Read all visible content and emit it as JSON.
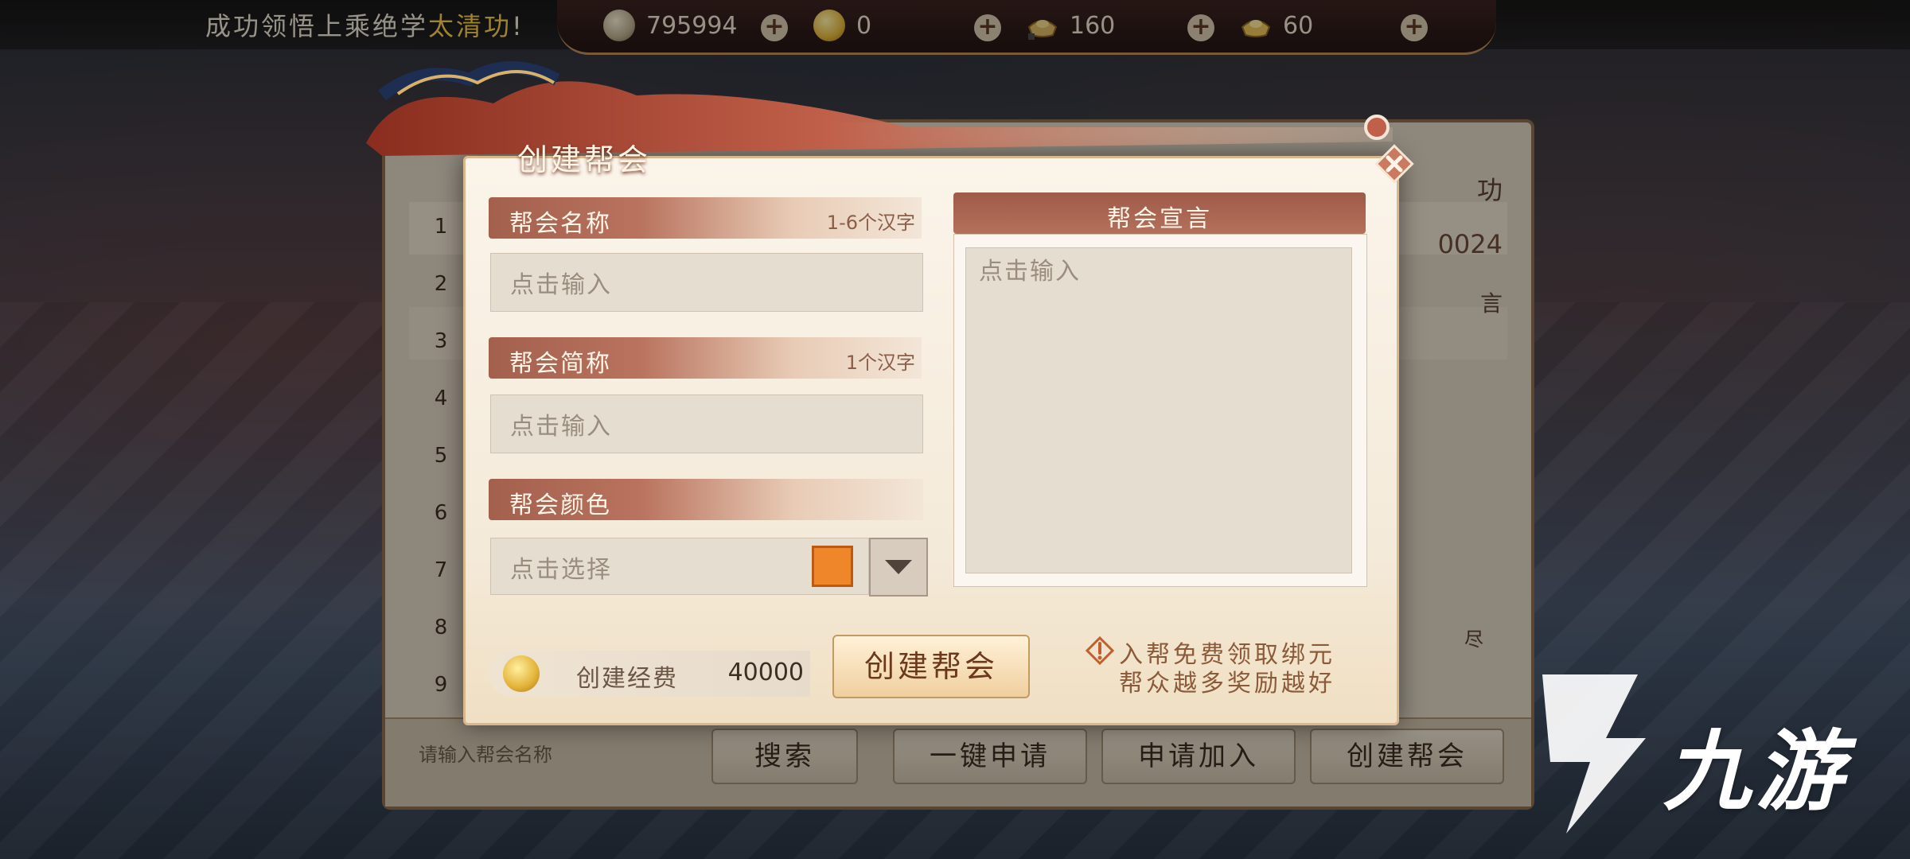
{
  "notice": {
    "prefix": "成功领悟上乘绝学",
    "highlight": "太清功",
    "suffix": "!"
  },
  "resources": [
    {
      "name": "copper-coin",
      "value": "795994",
      "color": "#b8a98c"
    },
    {
      "name": "gold-coin",
      "value": "0",
      "color": "#e0b43a"
    },
    {
      "name": "bound-ingot",
      "value": "160",
      "color": "#d9b562"
    },
    {
      "name": "gold-ingot",
      "value": "60",
      "color": "#e6c05a"
    }
  ],
  "background_list": {
    "row_numbers": [
      "1",
      "2",
      "3",
      "4",
      "5",
      "6",
      "7",
      "8",
      "9"
    ],
    "right_fragments": {
      "tab": "功",
      "value": "0024",
      "label": "言",
      "small": "尽"
    },
    "search_placeholder": "请输入帮会名称",
    "buttons": {
      "search": "搜索",
      "quick_apply": "一键申请",
      "apply": "申请加入",
      "create": "创建帮会"
    }
  },
  "dialog": {
    "title": "创建帮会",
    "name_section": {
      "label": "帮会名称",
      "hint": "1-6个汉字",
      "placeholder": "点击输入"
    },
    "abbr_section": {
      "label": "帮会简称",
      "hint": "1个汉字",
      "placeholder": "点击输入"
    },
    "color_section": {
      "label": "帮会颜色",
      "placeholder": "点击选择",
      "selected_color": "#f0862a"
    },
    "declaration": {
      "label": "帮会宣言",
      "placeholder": "点击输入"
    },
    "cost": {
      "label": "创建经费",
      "value": "40000"
    },
    "create_button": "创建帮会",
    "tip_line1": "入帮免费领取绑元",
    "tip_line2": "帮众越多奖励越好"
  },
  "watermark": {
    "text": "九游"
  },
  "colors": {
    "accent": "#b5705b",
    "highlight": "#f3c94b",
    "button_text": "#6b3a1c"
  }
}
